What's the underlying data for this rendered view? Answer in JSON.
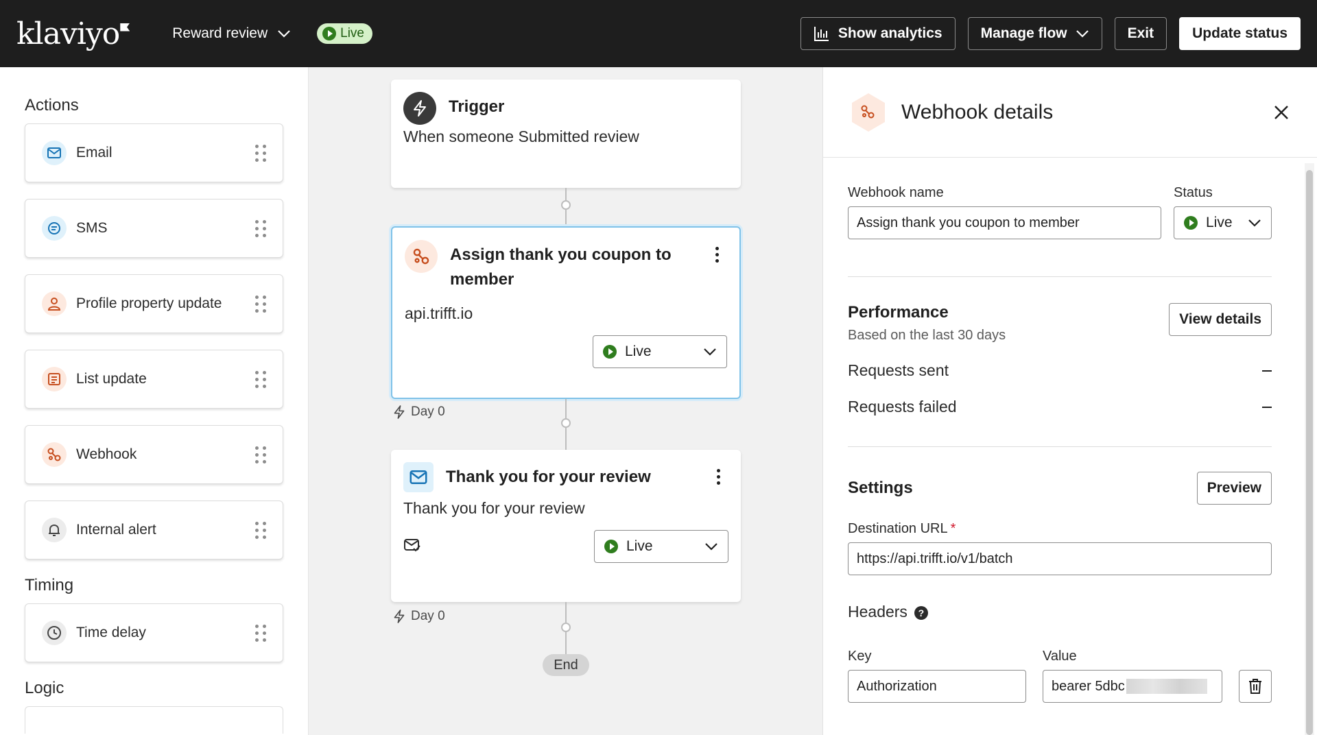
{
  "header": {
    "logo": "klaviyo",
    "flow_name": "Reward review",
    "status": "Live",
    "show_analytics": "Show analytics",
    "manage_flow": "Manage flow",
    "exit": "Exit",
    "update_status": "Update status"
  },
  "sidebar": {
    "actions_title": "Actions",
    "actions": [
      {
        "label": "Email",
        "icon": "mail-icon"
      },
      {
        "label": "SMS",
        "icon": "chat-icon"
      },
      {
        "label": "Profile property update",
        "icon": "user-icon"
      },
      {
        "label": "List update",
        "icon": "list-icon"
      },
      {
        "label": "Webhook",
        "icon": "webhook-icon"
      },
      {
        "label": "Internal alert",
        "icon": "bell-icon"
      }
    ],
    "timing_title": "Timing",
    "timing": [
      {
        "label": "Time delay",
        "icon": "clock-icon"
      }
    ],
    "logic_title": "Logic"
  },
  "canvas": {
    "trigger": {
      "title": "Trigger",
      "description": "When someone Submitted review"
    },
    "webhook_node": {
      "title": "Assign thank you coupon to member",
      "description": "api.trifft.io",
      "status": "Live",
      "day": "Day 0"
    },
    "email_node": {
      "title": "Thank you for your review",
      "description": "Thank you for your review",
      "status": "Live",
      "day": "Day 0"
    },
    "end": "End"
  },
  "panel": {
    "title": "Webhook details",
    "webhook_name_label": "Webhook name",
    "webhook_name_value": "Assign thank you coupon to member",
    "status_label": "Status",
    "status_value": "Live",
    "performance_title": "Performance",
    "performance_sub": "Based on the last 30 days",
    "view_details": "View details",
    "requests_sent": "Requests sent",
    "requests_failed": "Requests failed",
    "settings_title": "Settings",
    "preview": "Preview",
    "destination_label": "Destination URL",
    "destination_value": "https://api.trifft.io/v1/batch",
    "headers_label": "Headers",
    "key_label": "Key",
    "value_label": "Value",
    "key_value": "Authorization",
    "value_value": "bearer 5dbc"
  },
  "colors": {
    "topbar": "#1e1e1e",
    "live_green": "#2f7d1e",
    "webhook_orange": "#c64d1d",
    "email_blue": "#1673b5",
    "selected_border": "#7fc2e8"
  }
}
